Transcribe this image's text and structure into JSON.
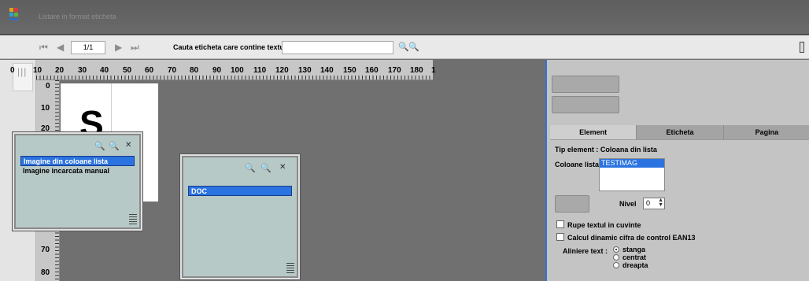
{
  "window": {
    "title": "Listare in format eticheta"
  },
  "toolbar": {
    "first_icon": "⏮",
    "prev_icon": "◀",
    "page": "1/1",
    "next_icon": "▶",
    "last_icon": "⏭",
    "search_label": "Cauta eticheta care contine textul :",
    "search_value": ""
  },
  "ruler": {
    "h_ticks": [
      "0",
      "10",
      "20",
      "30",
      "40",
      "50",
      "60",
      "70",
      "80",
      "90",
      "100",
      "110",
      "120",
      "130",
      "140",
      "150",
      "160",
      "170",
      "180",
      "1"
    ],
    "v_ticks": [
      "0",
      "10",
      "20",
      "70",
      "80"
    ]
  },
  "canvas": {
    "preview_letter": "S"
  },
  "popup_left": {
    "items": [
      "Imagine din coloane lista",
      "Imagine incarcata manual"
    ],
    "selected_index": 0
  },
  "popup_right": {
    "items": [
      "DOC"
    ],
    "selected_index": 0
  },
  "panel": {
    "tabs": [
      "Element",
      "Eticheta",
      "Pagina"
    ],
    "active_tab": "Element",
    "element_type": "Tip element : Coloana din lista",
    "columns_label": "Coloane lista",
    "columns_list": [
      "TESTIMAG"
    ],
    "level_label": "Nivel",
    "level_value": "0",
    "wrap_label": "Rupe textul in cuvinte",
    "ean_label": "Calcul dinamic cifra de control EAN13",
    "align_label": "Aliniere text :",
    "align_options": [
      "stanga",
      "centrat",
      "dreapta"
    ],
    "align_selected": "stanga"
  },
  "colors": {
    "selection": "#2b73e0",
    "popup_bg": "#b7c9c7",
    "panel_border": "#3b6fd6"
  }
}
